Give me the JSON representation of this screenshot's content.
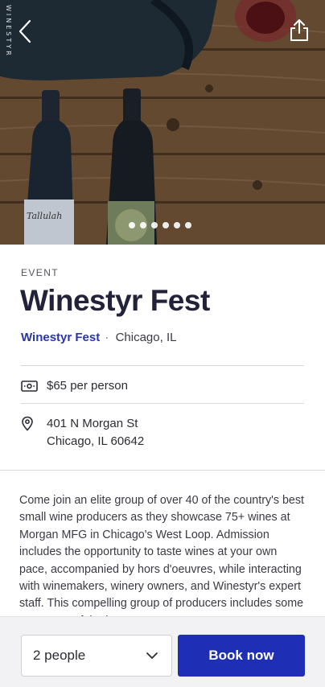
{
  "hero": {
    "brand_vertical": "WINESTYR",
    "bottle_label": "Tallulah",
    "carousel_dots": 6
  },
  "event": {
    "category": "EVENT",
    "title": "Winestyr Fest",
    "organizer": "Winestyr Fest",
    "separator": "·",
    "city": "Chicago, IL",
    "price": "$65 per person",
    "address_line1": "401 N Morgan St",
    "address_line2": "Chicago, IL 60642",
    "description": "Come join an elite group of over 40 of the country's best small wine producers as they showcase 75+ wines at Morgan MFG in Chicago's West Loop. Admission includes the opportunity to taste wines at your own pace, accompanied by hors d'oeuvres, while interacting with winemakers, winery owners, and Winestyr's expert staff. This compelling group of producers includes some true gems of the best"
  },
  "booking": {
    "people_value": "2 people",
    "book_label": "Book now"
  },
  "colors": {
    "accent": "#1f2fb5",
    "link": "#2b36a6",
    "title": "#22223a"
  },
  "icons": [
    "back-arrow-icon",
    "share-icon",
    "ticket-price-icon",
    "location-pin-icon",
    "chevron-down-icon"
  ]
}
